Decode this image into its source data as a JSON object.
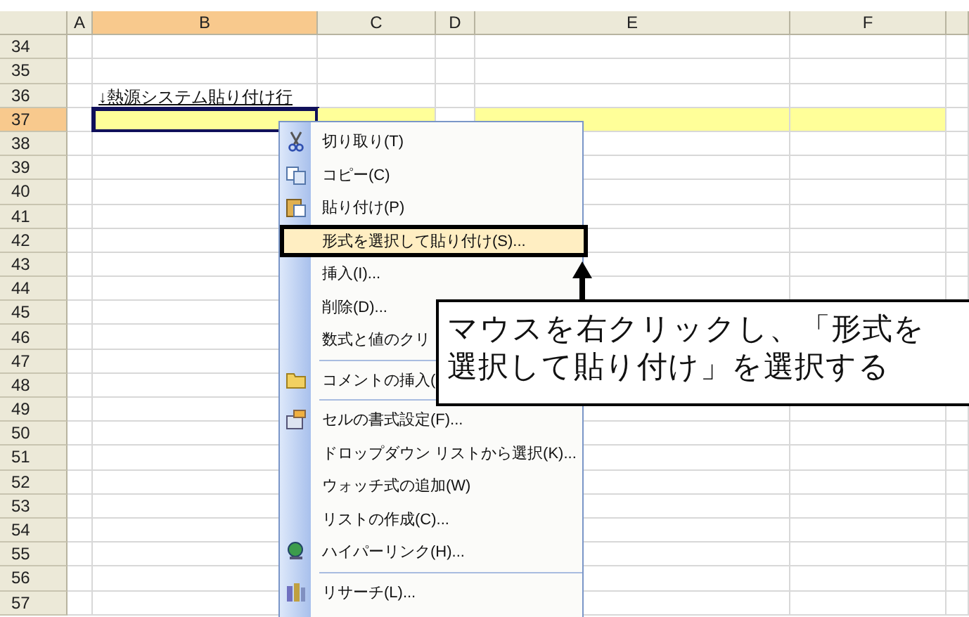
{
  "sheet": {
    "columns": [
      {
        "label": "A",
        "selected": false
      },
      {
        "label": "B",
        "selected": true
      },
      {
        "label": "C",
        "selected": false
      },
      {
        "label": "D",
        "selected": false
      },
      {
        "label": "E",
        "selected": false
      },
      {
        "label": "F",
        "selected": false
      }
    ],
    "rows": [
      {
        "label": "34",
        "selected": false
      },
      {
        "label": "35",
        "selected": false
      },
      {
        "label": "36",
        "selected": false,
        "cell_b": "↓熱源システム貼り付け行"
      },
      {
        "label": "37",
        "selected": true,
        "highlighted": true
      },
      {
        "label": "38",
        "selected": false
      },
      {
        "label": "39",
        "selected": false
      },
      {
        "label": "40",
        "selected": false
      },
      {
        "label": "41",
        "selected": false
      },
      {
        "label": "42",
        "selected": false
      },
      {
        "label": "43",
        "selected": false
      },
      {
        "label": "44",
        "selected": false
      },
      {
        "label": "45",
        "selected": false
      },
      {
        "label": "46",
        "selected": false
      },
      {
        "label": "47",
        "selected": false
      },
      {
        "label": "48",
        "selected": false
      },
      {
        "label": "49",
        "selected": false
      },
      {
        "label": "50",
        "selected": false
      },
      {
        "label": "51",
        "selected": false
      },
      {
        "label": "52",
        "selected": false
      },
      {
        "label": "53",
        "selected": false
      },
      {
        "label": "54",
        "selected": false
      },
      {
        "label": "55",
        "selected": false
      },
      {
        "label": "56",
        "selected": false
      },
      {
        "label": "57",
        "selected": false
      }
    ]
  },
  "context_menu": {
    "items": [
      {
        "kind": "item",
        "label": "切り取り(T)",
        "selected": false
      },
      {
        "kind": "item",
        "label": "コピー(C)",
        "selected": false
      },
      {
        "kind": "item",
        "label": "貼り付け(P)",
        "selected": false
      },
      {
        "kind": "item",
        "label": "形式を選択して貼り付け(S)...",
        "selected": true
      },
      {
        "kind": "item",
        "label": "挿入(I)...",
        "selected": false
      },
      {
        "kind": "item",
        "label": "削除(D)...",
        "selected": false
      },
      {
        "kind": "item",
        "label": "数式と値のクリ",
        "selected": false
      },
      {
        "kind": "separator"
      },
      {
        "kind": "item",
        "label": "コメントの挿入(",
        "selected": false
      },
      {
        "kind": "separator"
      },
      {
        "kind": "item",
        "label": "セルの書式設定(F)...",
        "selected": false
      },
      {
        "kind": "item",
        "label": "ドロップダウン リストから選択(K)...",
        "selected": false
      },
      {
        "kind": "item",
        "label": "ウォッチ式の追加(W)",
        "selected": false
      },
      {
        "kind": "item",
        "label": "リストの作成(C)...",
        "selected": false
      },
      {
        "kind": "item",
        "label": "ハイパーリンク(H)...",
        "selected": false
      },
      {
        "kind": "separator"
      },
      {
        "kind": "item",
        "label": "リサーチ(L)...",
        "selected": false
      }
    ]
  },
  "callout": {
    "text": "マウスを右クリックし、「形式を選択して貼り付け」を選択する"
  }
}
